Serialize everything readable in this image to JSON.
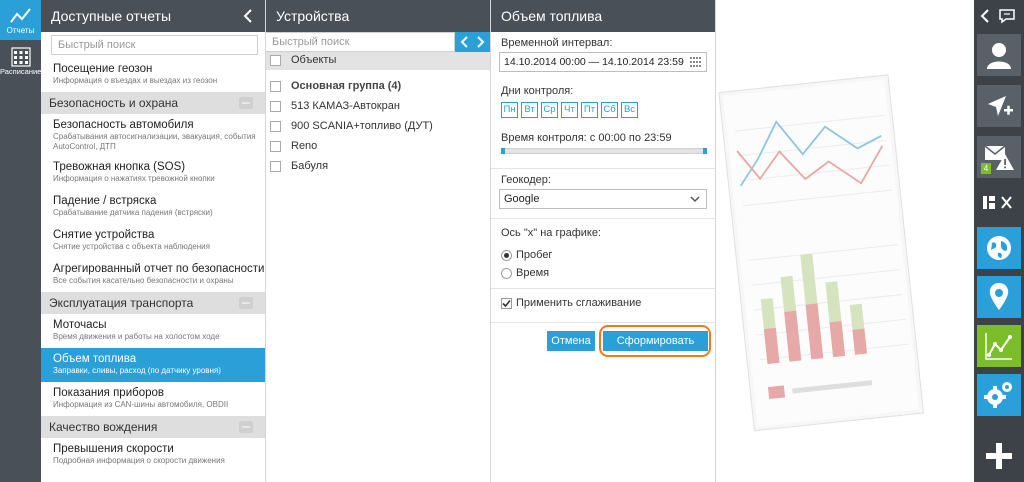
{
  "rail": {
    "reports_label": "Отчеты",
    "schedule_label": "Расписание"
  },
  "reports": {
    "title": "Доступные отчеты",
    "search_placeholder": "Быстрый поиск",
    "items": [
      {
        "kind": "item",
        "title": "Посещение геозон",
        "sub": "Информация о въездах и выездах из геозон"
      },
      {
        "kind": "group",
        "title": "Безопасность и охрана"
      },
      {
        "kind": "item",
        "title": "Безопасность автомобиля",
        "sub": "Срабатывания автосигнализации, эвакуация, события AutoControl, ДТП",
        "tall": true
      },
      {
        "kind": "item",
        "title": "Тревожная кнопка (SOS)",
        "sub": "Информация о нажатиях тревожной кнопки"
      },
      {
        "kind": "item",
        "title": "Падение / встряска",
        "sub": "Срабатывание датчика падения (встряски)"
      },
      {
        "kind": "item",
        "title": "Снятие устройства",
        "sub": "Снятие устройства с объекта наблюдения"
      },
      {
        "kind": "item",
        "title": "Агрегированный отчет по безопасности",
        "sub": "Все события касательно безопасности и охраны"
      },
      {
        "kind": "group",
        "title": "Эксплуатация транспорта"
      },
      {
        "kind": "item",
        "title": "Моточасы",
        "sub": "Время движения и работы на холостом ходе"
      },
      {
        "kind": "item",
        "title": "Объем топлива",
        "sub": "Заправки, сливы, расход (по датчику уровня)",
        "active": true
      },
      {
        "kind": "item",
        "title": "Показания приборов",
        "sub": "Информация из CAN-шины автомобиля, OBDII"
      },
      {
        "kind": "group",
        "title": "Качество вождения"
      },
      {
        "kind": "item",
        "title": "Превышения скорости",
        "sub": "Подробная информация о скорости движения"
      }
    ]
  },
  "devices": {
    "title": "Устройства",
    "search_placeholder": "Быстрый поиск",
    "objects_header": "Объекты",
    "group_label": "Основная группа (4)",
    "items": [
      "513 КАМАЗ-Автокран",
      "900 SCANIA+топливо (ДУТ)",
      "Reno",
      "Бабуля"
    ]
  },
  "fuel": {
    "title": "Объем топлива",
    "interval_label": "Временной интервал:",
    "interval_value": "14.10.2014 00:00 — 14.10.2014 23:59",
    "days_label": "Дни контроля:",
    "days": [
      "Пн",
      "Вт",
      "Ср",
      "Чт",
      "Пт",
      "Сб",
      "Вс"
    ],
    "time_label": "Время контроля: с 00:00 по 23:59",
    "time_range": [
      0,
      1
    ],
    "geocoder_label": "Геокодер:",
    "geocoder_value": "Google",
    "xaxis_label": "Ось \"x\" на графике:",
    "xaxis_options": [
      "Пробег",
      "Время"
    ],
    "xaxis_selected": "Пробег",
    "smoothing_label": "Применить сглаживание",
    "smoothing_checked": true,
    "cancel_label": "Отмена",
    "submit_label": "Сформировать отчет"
  },
  "right_rail": {
    "messages_count": "4"
  },
  "colors": {
    "accent": "#2a9fd8",
    "dark": "#4a5058",
    "green": "#7cbd2a",
    "highlight": "#f07a1a"
  }
}
